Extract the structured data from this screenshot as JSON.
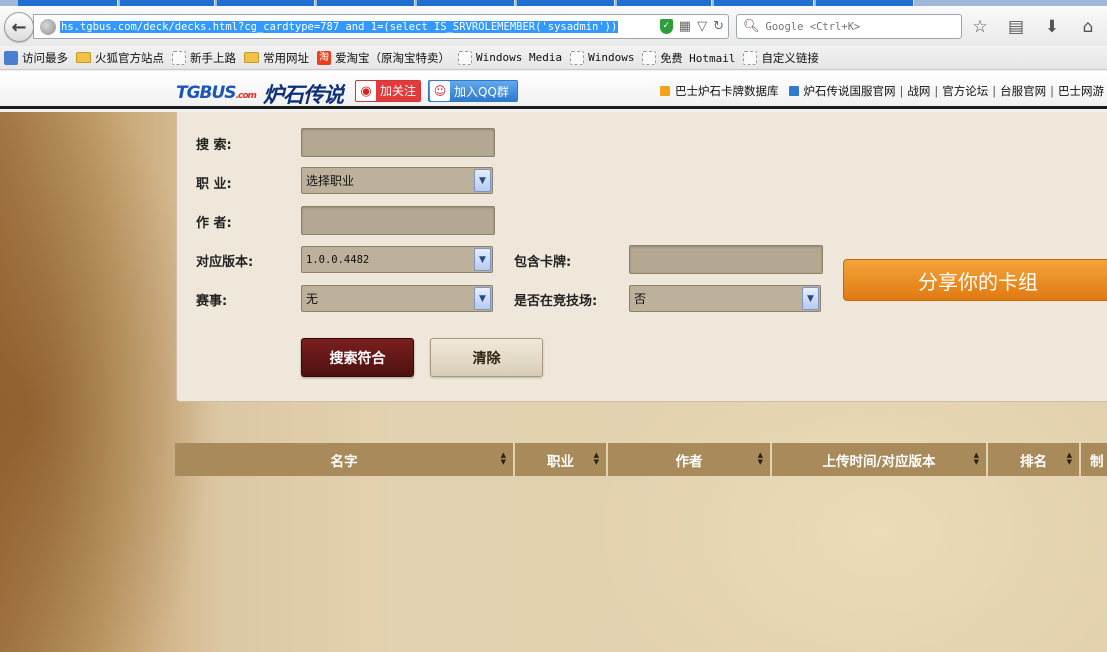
{
  "browser": {
    "url": "hs.tgbus.com/deck/decks.html?cg_cardtype=787 and 1=(select IS_SRVROLEMEMBER('sysadmin'))",
    "search_placeholder": "Google <Ctrl+K>"
  },
  "bookmarks": [
    {
      "label": "访问最多",
      "icon": "most-visited-icon"
    },
    {
      "label": "火狐官方站点",
      "icon": "folder-icon"
    },
    {
      "label": "新手上路",
      "icon": "page-icon"
    },
    {
      "label": "常用网址",
      "icon": "folder-icon"
    },
    {
      "label": "爱淘宝（原淘宝特卖）",
      "icon": "taobao-icon"
    },
    {
      "label": "Windows Media",
      "icon": "page-icon"
    },
    {
      "label": "Windows",
      "icon": "page-icon"
    },
    {
      "label": "免费 Hotmail",
      "icon": "page-icon"
    },
    {
      "label": "自定义链接",
      "icon": "page-icon"
    }
  ],
  "site": {
    "logo_main": "TGBUS",
    "logo_suffix": ".com",
    "logo_game": "炉石传说",
    "weibo_label": "加关注",
    "qq_label": "加入QQ群",
    "links": [
      "巴士炉石卡牌数据库",
      "炉石传说国服官网",
      "战网",
      "官方论坛",
      "台服官网",
      "巴士网游"
    ]
  },
  "form": {
    "search_label": "搜 索:",
    "class_label": "职 业:",
    "class_value": "选择职业",
    "author_label": "作 者:",
    "version_label": "对应版本:",
    "version_value": "1.0.0.4482",
    "card_label": "包含卡牌:",
    "event_label": "赛事:",
    "event_value": "无",
    "arena_label": "是否在竞技场:",
    "arena_value": "否",
    "search_button": "搜索符合",
    "clear_button": "清除",
    "share_button": "分享你的卡组"
  },
  "table": {
    "columns": [
      "名字",
      "职业",
      "作者",
      "上传时间/对应版本",
      "排名",
      "制"
    ]
  },
  "colors": {
    "accent_orange": "#e8861e",
    "search_button": "#5e1414",
    "table_header": "#a88a5b"
  }
}
